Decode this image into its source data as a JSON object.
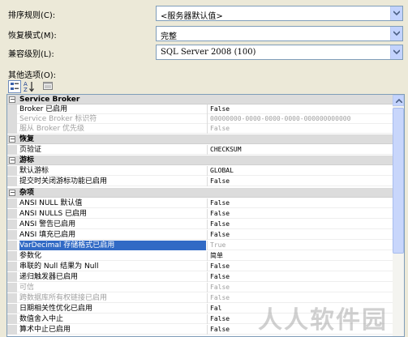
{
  "options": {
    "collation": {
      "label": "排序规则(C):",
      "value": "<服务器默认值>"
    },
    "recovery_model": {
      "label": "恢复模式(M):",
      "value": "完整"
    },
    "compatibility_level": {
      "label": "兼容级别(L):",
      "value": "SQL Server 2008 (100)"
    }
  },
  "other_options": {
    "label": "其他选项(O):"
  },
  "toolbar": {
    "categorized_icon": "categorized-icon",
    "alphabetical_icon": "alphabetical-icon",
    "property_pages_icon": "property-pages-icon"
  },
  "property_grid": {
    "groups": [
      {
        "name": "Service Broker",
        "rows": [
          {
            "name": "Broker 已启用",
            "value": "False",
            "disabled": false
          },
          {
            "name": "Service Broker 标识符",
            "value": "00000000-0000-0000-0000-000000000000",
            "disabled": true
          },
          {
            "name": "服从 Broker 优先级",
            "value": "False",
            "disabled": true
          }
        ]
      },
      {
        "name": "恢复",
        "rows": [
          {
            "name": "页验证",
            "value": "CHECKSUM",
            "disabled": false
          }
        ]
      },
      {
        "name": "游标",
        "rows": [
          {
            "name": "默认游标",
            "value": "GLOBAL",
            "disabled": false
          },
          {
            "name": "提交时关闭游标功能已启用",
            "value": "False",
            "disabled": false
          }
        ]
      },
      {
        "name": "杂项",
        "rows": [
          {
            "name": "ANSI NULL 默认值",
            "value": "False",
            "disabled": false
          },
          {
            "name": "ANSI NULLS 已启用",
            "value": "False",
            "disabled": false
          },
          {
            "name": "ANSI 警告已启用",
            "value": "False",
            "disabled": false
          },
          {
            "name": "ANSI 填充已启用",
            "value": "False",
            "disabled": false
          },
          {
            "name": "VarDecimal 存储格式已启用",
            "value": "True",
            "disabled": false,
            "selected": true
          },
          {
            "name": "参数化",
            "value": "简单",
            "disabled": false
          },
          {
            "name": "串联的 Null 结果为 Null",
            "value": "False",
            "disabled": false
          },
          {
            "name": "递归触发器已启用",
            "value": "False",
            "disabled": false
          },
          {
            "name": "可信",
            "value": "False",
            "disabled": true
          },
          {
            "name": "跨数据库所有权链接已启用",
            "value": "False",
            "disabled": true
          },
          {
            "name": "日期相关性优化已启用",
            "value": "Fal",
            "disabled": false
          },
          {
            "name": "数值舍入中止",
            "value": "False",
            "disabled": false
          },
          {
            "name": "算术中止已启用",
            "value": "False",
            "disabled": false
          }
        ]
      }
    ]
  },
  "watermark": "人人软件园"
}
